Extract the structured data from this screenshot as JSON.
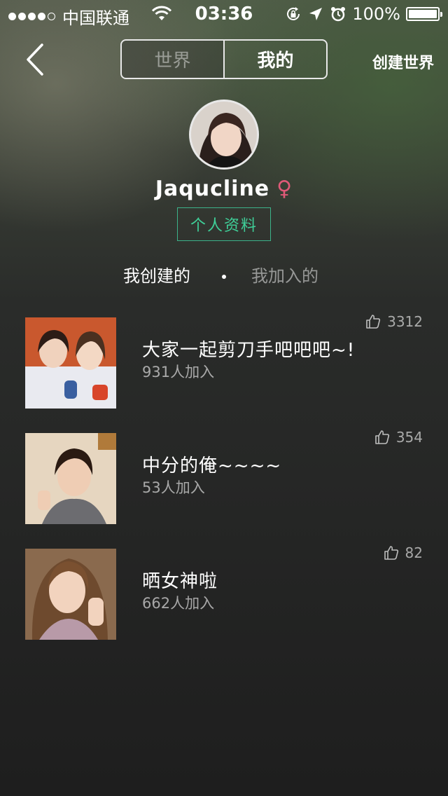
{
  "status_bar": {
    "carrier": "中国联通",
    "time": "03:36",
    "battery": "100%"
  },
  "nav": {
    "segments": [
      "世界",
      "我的"
    ],
    "active_segment": "我的",
    "create_label": "创建世界"
  },
  "profile": {
    "username": "Jaqucline",
    "gender_symbol": "♀",
    "profile_button": "个人资料"
  },
  "tabs": {
    "created": "我创建的",
    "joined": "我加入的",
    "active": "我创建的"
  },
  "worlds": [
    {
      "title": "大家一起剪刀手吧吧吧~!",
      "members": "931人加入",
      "likes": "3312"
    },
    {
      "title": "中分的俺~~~~",
      "members": "53人加入",
      "likes": "354"
    },
    {
      "title": "晒女神啦",
      "members": "662人加入",
      "likes": "82"
    }
  ],
  "colors": {
    "accent_green": "#3fcf98",
    "gender_pink": "#e05a78"
  },
  "icons": {
    "back": "chevron-left-icon",
    "like": "thumbs-up-icon",
    "wifi": "wifi-icon",
    "lock_rotation": "rotation-lock-icon",
    "location": "location-arrow-icon",
    "alarm": "alarm-icon"
  }
}
